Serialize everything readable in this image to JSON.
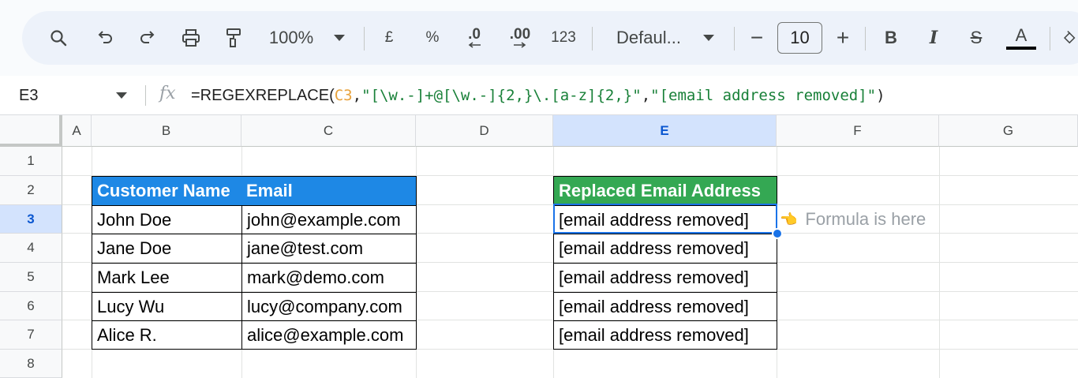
{
  "toolbar": {
    "zoom": "100%",
    "currency": "£",
    "percent": "%",
    "dec_decrease": ".0",
    "dec_increase": ".00",
    "number_format": "123",
    "font": "Defaul...",
    "font_size": "10",
    "minus": "−",
    "plus": "+",
    "bold": "B",
    "italic": "I",
    "strike": "S",
    "text_color": "A"
  },
  "formula_bar": {
    "cell_ref": "E3",
    "fx": "fx",
    "formula_prefix": "=REGEXREPLACE(",
    "formula_ref": "C3",
    "formula_sep1": ",",
    "formula_pattern": "\"[\\w.-]+@[\\w.-]{2,}\\.[a-z]{2,}\"",
    "formula_sep2": ",",
    "formula_replacement": "\"[email address removed]\"",
    "formula_suffix": ")"
  },
  "columns": [
    "A",
    "B",
    "C",
    "D",
    "E",
    "F",
    "G"
  ],
  "rows": [
    "1",
    "2",
    "3",
    "4",
    "5",
    "6",
    "7",
    "8"
  ],
  "table": {
    "header_name": "Customer Name",
    "header_email": "Email",
    "rows": [
      {
        "name": "John Doe",
        "email": "john@example.com"
      },
      {
        "name": "Jane Doe",
        "email": "jane@test.com"
      },
      {
        "name": "Mark Lee",
        "email": "mark@demo.com"
      },
      {
        "name": "Lucy Wu",
        "email": "lucy@company.com"
      },
      {
        "name": "Alice R.",
        "email": "alice@example.com"
      }
    ]
  },
  "result": {
    "header": "Replaced Email Address",
    "values": [
      "[email address removed]",
      "[email address removed]",
      "[email address removed]",
      "[email address removed]",
      "[email address removed]"
    ]
  },
  "note": {
    "icon": "👈",
    "text": "Formula is here"
  },
  "colors": {
    "header_blue": "#1e88e5",
    "header_green": "#34a853",
    "selection": "#1a73e8",
    "formula_ref": "#e8a33e",
    "formula_string": "#188038"
  }
}
